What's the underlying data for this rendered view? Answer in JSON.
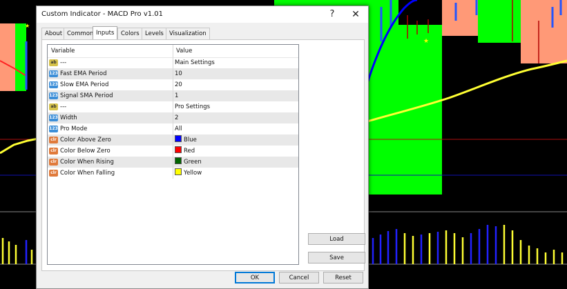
{
  "dialog": {
    "title": "Custom Indicator - MACD Pro v1.01",
    "help_symbol": "?",
    "close_symbol": "✕"
  },
  "tabs": [
    {
      "label": "About",
      "active": false
    },
    {
      "label": "Common",
      "active": false
    },
    {
      "label": "Inputs",
      "active": true
    },
    {
      "label": "Colors",
      "active": false
    },
    {
      "label": "Levels",
      "active": false
    },
    {
      "label": "Visualization",
      "active": false
    }
  ],
  "grid": {
    "headers": {
      "variable": "Variable",
      "value": "Value"
    },
    "rows": [
      {
        "icon": "ab",
        "variable": "---",
        "value": "Main Settings"
      },
      {
        "icon": "123",
        "variable": "Fast EMA Period",
        "value": "10"
      },
      {
        "icon": "123",
        "variable": "Slow EMA Period",
        "value": "20"
      },
      {
        "icon": "123",
        "variable": "Signal SMA Period",
        "value": "1"
      },
      {
        "icon": "ab",
        "variable": "---",
        "value": "Pro Settings"
      },
      {
        "icon": "123",
        "variable": "Width",
        "value": "2"
      },
      {
        "icon": "123",
        "variable": "Pro Mode",
        "value": "All"
      },
      {
        "icon": "clr",
        "variable": "Color Above Zero",
        "value": "Blue",
        "swatch": "#0000ff"
      },
      {
        "icon": "clr",
        "variable": "Color Below Zero",
        "value": "Red",
        "swatch": "#ff0000"
      },
      {
        "icon": "clr",
        "variable": "Color When Rising",
        "value": "Green",
        "swatch": "#006400"
      },
      {
        "icon": "clr",
        "variable": "Color When Falling",
        "value": "Yellow",
        "swatch": "#ffff00"
      }
    ]
  },
  "side_buttons": {
    "load": "Load",
    "save": "Save"
  },
  "footer_buttons": {
    "ok": "OK",
    "cancel": "Cancel",
    "reset": "Reset"
  },
  "icons": {
    "ab": "text-param-icon",
    "123": "number-param-icon",
    "clr": "color-param-icon"
  },
  "chart_colors": {
    "background": "#000000",
    "green_zone": "#00ff00",
    "salmon_zone": "#ff9977",
    "ma_line_yellow": "#ffff33",
    "ma_line_blue": "#0000ff",
    "histogram_yellow": "#ffff33",
    "histogram_blue": "#2222ff"
  }
}
